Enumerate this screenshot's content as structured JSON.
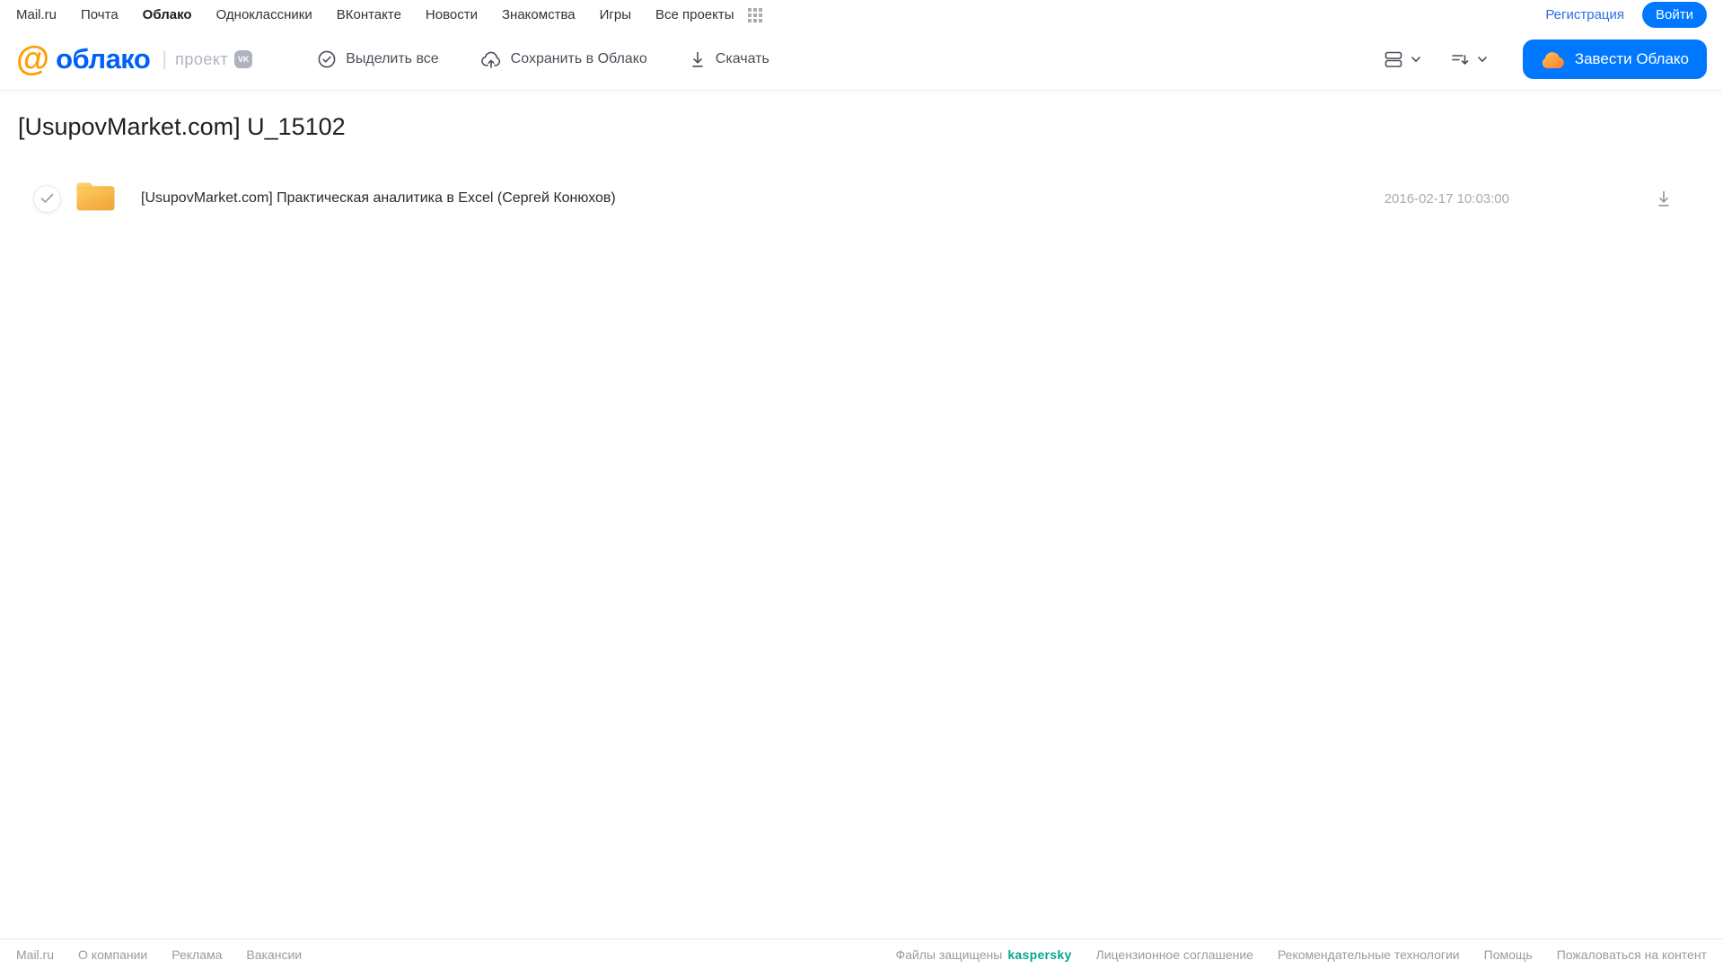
{
  "topnav": {
    "links": [
      "Mail.ru",
      "Почта",
      "Облако",
      "Одноклассники",
      "ВКонтакте",
      "Новости",
      "Знакомства",
      "Игры",
      "Все проекты"
    ],
    "registration_label": "Регистрация",
    "login_label": "Войти"
  },
  "header": {
    "logo": {
      "at_symbol": "@",
      "text": "облако"
    },
    "divider": "|",
    "project_label": "проект",
    "vk_badge": "VK",
    "toolbar": {
      "select_all_label": "Выделить все",
      "save_to_cloud_label": "Сохранить в Облако",
      "download_label": "Скачать"
    },
    "get_cloud_button_label": "Завести Облако"
  },
  "main": {
    "title": "[UsupovMarket.com] U_15102",
    "files": [
      {
        "type": "folder",
        "name": "[UsupovMarket.com] Практическая аналитика в Excel (Сергей Конюхов)",
        "date": "2016-02-17 10:03:00"
      }
    ]
  },
  "footer": {
    "left_links": [
      "Mail.ru",
      "О компании",
      "Реклама",
      "Вакансии"
    ],
    "protected_text": "Файлы защищены",
    "kaspersky_label": "kaspersky",
    "right_links": [
      "Лицензионное соглашение",
      "Рекомендательные технологии",
      "Помощь",
      "Пожаловаться на контент"
    ]
  },
  "colors": {
    "accent_blue": "#0077FF",
    "logo_blue": "#005FF9",
    "logo_orange": "#FF9E00",
    "folder_yellow": "#F9B93F",
    "kaspersky_green": "#00A88E"
  }
}
